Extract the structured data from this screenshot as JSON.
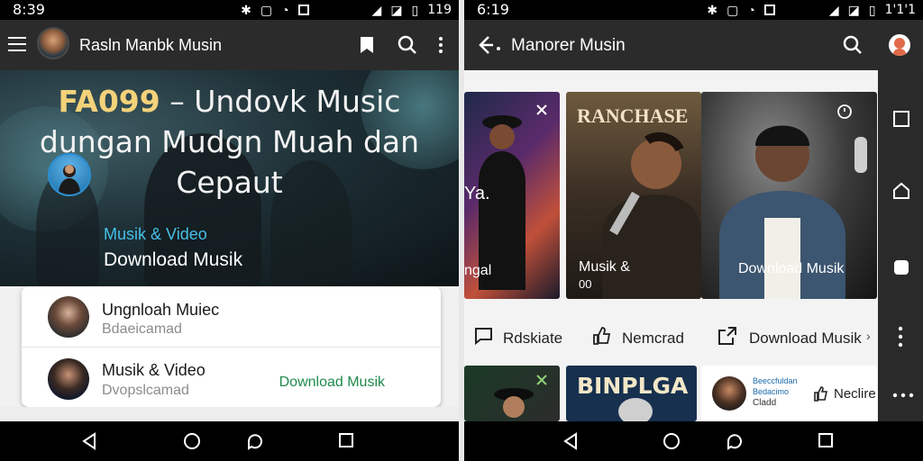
{
  "left": {
    "status": {
      "time": "8:39",
      "battery": "119"
    },
    "appbar": {
      "title": "Rasln Manbk Musin"
    },
    "hero": {
      "title_accent": "FA099",
      "title_rest_1": " – Undovk Music",
      "title_line_2": "dungan Mudgn Muah dan",
      "title_line_3": "Cepaut",
      "sub_label": "Musik & Video",
      "sub_title": "Download Musik"
    },
    "list": [
      {
        "title": "Ungnloah Muiec",
        "subtitle": "Bdaeicamad",
        "action": ""
      },
      {
        "title": "Musik & Video",
        "subtitle": "Dvopslcamad",
        "action": "Download Musik"
      }
    ]
  },
  "right": {
    "status": {
      "time": "6:19",
      "battery": "1'1'1"
    },
    "appbar": {
      "title": "Manorer Musin"
    },
    "tiles": [
      {
        "label_top": "Ya.",
        "label_bottom": "ngal"
      },
      {
        "brand": "RANCHASE",
        "label_1": "Musik  &",
        "label_2": "00"
      },
      {
        "label": "Download Musik"
      }
    ],
    "actions": [
      {
        "label": "Rdskiate"
      },
      {
        "label": "Nemcrad"
      },
      {
        "label": "Download Musik"
      }
    ],
    "bottom_tiles": [
      {
        "brand": "BINPLGA"
      },
      {
        "line_1": "Beeccfuldan",
        "line_2": "Bedacimo",
        "line_3": "Cladd",
        "action": "Neclire"
      }
    ]
  },
  "colors": {
    "accent_green": "#1f8a4c",
    "accent_blue": "#45c0e8",
    "title_gold": "#f3d27a",
    "appbar": "#2b2b2b"
  }
}
